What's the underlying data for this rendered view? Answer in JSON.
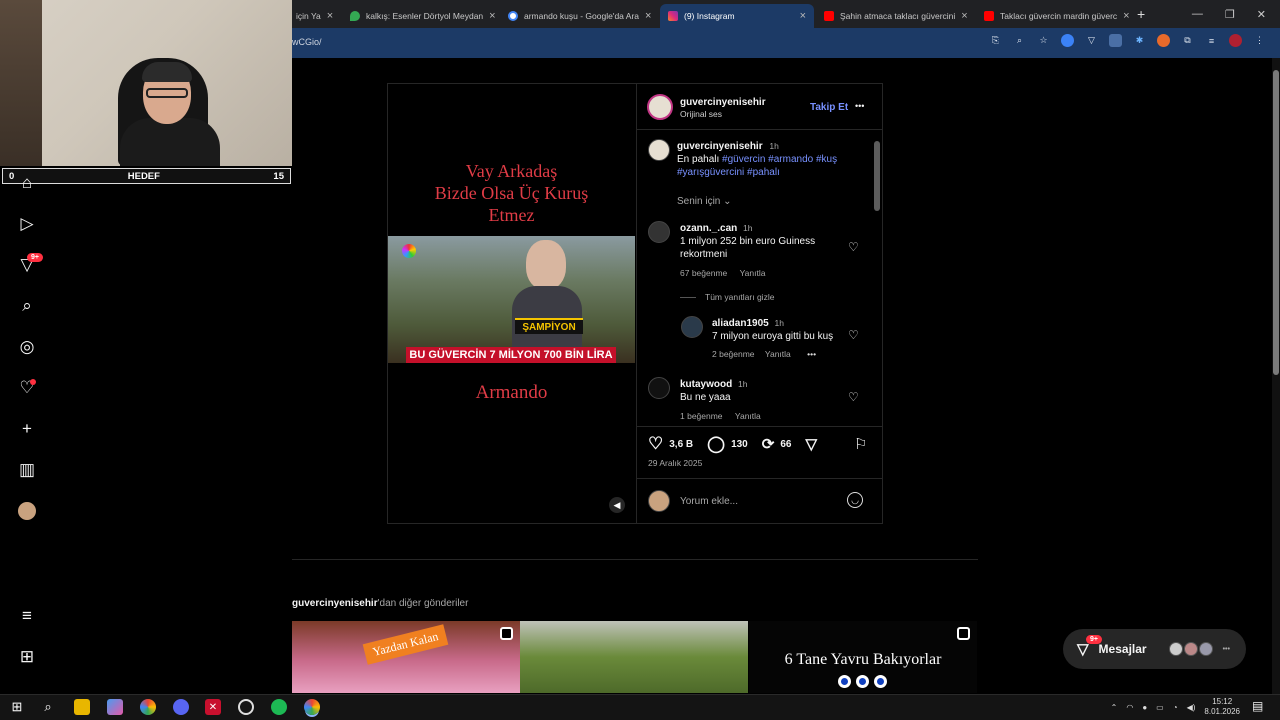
{
  "browser": {
    "tabs": [
      {
        "label": "için Ya",
        "icon": "generic-tab-icon",
        "active": false
      },
      {
        "label": "kalkış: Esenler Dörtyol Meydan",
        "icon": "maps-icon",
        "active": false
      },
      {
        "label": "armando kuşu - Google'da Ara",
        "icon": "google-icon",
        "active": false
      },
      {
        "label": "(9) Instagram",
        "icon": "instagram-icon",
        "active": true
      },
      {
        "label": "Şahin atmaca taklacı güvercini",
        "icon": "youtube-icon",
        "active": false
      },
      {
        "label": "Taklacı güvercin mardin güverc",
        "icon": "youtube-icon",
        "active": false
      }
    ],
    "new_tab": "+",
    "url": "wCGio/"
  },
  "stream_overlay": {
    "goal_start": "0",
    "goal_label": "HEDEF",
    "goal_target": "15"
  },
  "ig_nav": {
    "notifications_badge": "9+"
  },
  "post": {
    "author": "guvercinyenisehir",
    "audio": "Orijinal ses",
    "follow": "Takip Et",
    "more": "•••",
    "media": {
      "caption_line1": "Vay Arkadaş",
      "caption_line2": "Bizde Olsa Üç Kuruş",
      "caption_line3": "Etmez",
      "badge": "ŞAMPİYON",
      "banner": "BU GÜVERCİN 7 MİLYON 700 BİN LİRA",
      "name": "Armando"
    },
    "caption": {
      "user": "guvercinyenisehir",
      "time": "1h",
      "text": "En pahalı",
      "tags1": "#güvercin #armando #kuş",
      "tags2": "#yarışgüvercini #pahalı"
    },
    "sort_label": "Senin için",
    "comments": [
      {
        "user": "ozann._.can",
        "time": "1h",
        "text1": "1 milyon 252 bin euro Guiness",
        "text2": "rekortmeni",
        "likes": "67 beğenme",
        "reply": "Yanıtla"
      },
      {
        "user": "aliadan1905",
        "time": "1h",
        "text1": "7 milyon euroya gitti bu kuş",
        "text2": "",
        "likes": "2 beğenme",
        "reply": "Yanıtla",
        "more": "•••"
      },
      {
        "user": "kutaywood",
        "time": "1h",
        "text1": "Bu ne yaaa",
        "text2": "",
        "likes": "1 beğenme",
        "reply": "Yanıtla"
      }
    ],
    "hide_replies": "Tüm yanıtları gizle",
    "stats": {
      "likes": "3,6 B",
      "comments": "130",
      "reposts": "66"
    },
    "date": "29 Aralık 2025",
    "comment_placeholder": "Yorum ekle..."
  },
  "more_posts": {
    "user": "guvercinyenisehir",
    "suffix": "'dan diğer gönderiler",
    "thumb1_text": "Yazdan Kalan",
    "thumb3_text": "6 Tane Yavru Bakıyorlar"
  },
  "messages": {
    "label": "Mesajlar",
    "badge": "9+",
    "more": "•••"
  },
  "taskbar": {
    "time": "15:12",
    "date": "8.01.2026"
  }
}
